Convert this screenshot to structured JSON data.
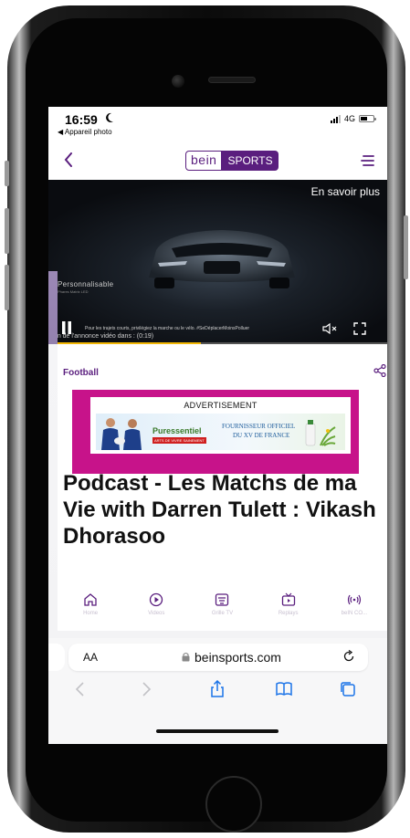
{
  "status_bar": {
    "time": "16:59",
    "back_app": "◀ Appareil photo",
    "network": "4G"
  },
  "site": {
    "logo_left": "bein",
    "logo_right": "SPORTS",
    "brand_color": "#5a1e7e"
  },
  "video_ad": {
    "cta": "En savoir plus",
    "brand_text": "Personnalisable",
    "brand_subtext": "Phares Matrix LED",
    "disclaimer": "Pour les trajets courts, privilégiez la marche ou le vélo. #SeDéplacerMoinsPolluer",
    "timer": "Fin de l'annonce vidéo dans : (0:19)",
    "progress_fraction": 0.45,
    "icons": [
      "pause-icon",
      "mute-icon",
      "fullscreen-icon"
    ]
  },
  "article": {
    "category": "Football",
    "headline": "Podcast - Les Matchs de ma Vie with Darren Tulett : Vikash Dhorasoo"
  },
  "advertisement": {
    "label": "ADVERTISEMENT",
    "brand": "Puressentiel",
    "brand_sub": "ARTS DE VIVRE SAINEMENT",
    "tagline_1": "FOURNISSEUR OFFICIEL",
    "tagline_2": "DU XV DE FRANCE",
    "frame_color": "#c7138a"
  },
  "site_nav": {
    "items": [
      {
        "label": "Home",
        "icon": "home-icon"
      },
      {
        "label": "Videos",
        "icon": "play-icon"
      },
      {
        "label": "Grille TV",
        "icon": "tv-guide-icon"
      },
      {
        "label": "Replays",
        "icon": "replay-icon"
      },
      {
        "label": "beIN CO...",
        "icon": "broadcast-icon"
      }
    ]
  },
  "browser": {
    "text_size": "AA",
    "url": "beinsports.com"
  }
}
